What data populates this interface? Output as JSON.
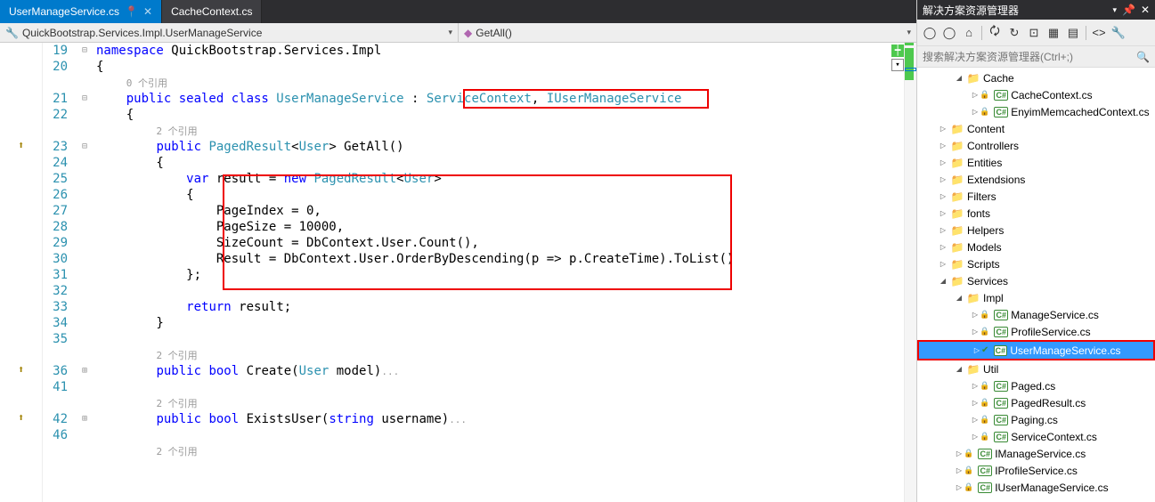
{
  "tabs": [
    {
      "label": "UserManageService.cs",
      "active": true,
      "pinned": true
    },
    {
      "label": "CacheContext.cs",
      "active": false,
      "pinned": false
    }
  ],
  "breadcrumb": {
    "left_icon": "🔧",
    "left": "QuickBootstrap.Services.Impl.UserManageService",
    "right_icon": "◆",
    "right": "GetAll()"
  },
  "code": {
    "lines": [
      {
        "num": "19",
        "fold": "⊟",
        "segs": [
          {
            "t": "namespace ",
            "c": "kw"
          },
          {
            "t": "QuickBootstrap.Services.Impl",
            "c": ""
          }
        ]
      },
      {
        "num": "20",
        "fold": "",
        "segs": [
          {
            "t": "{",
            "c": ""
          }
        ]
      },
      {
        "num": "",
        "fold": "",
        "segs": [
          {
            "t": "    ",
            "c": ""
          },
          {
            "t": "0 个引用",
            "c": "codelens"
          }
        ]
      },
      {
        "num": "21",
        "fold": "⊟",
        "segs": [
          {
            "t": "    ",
            "c": ""
          },
          {
            "t": "public sealed class ",
            "c": "kw"
          },
          {
            "t": "UserManageService",
            "c": "type"
          },
          {
            "t": " : ",
            "c": ""
          },
          {
            "t": "ServiceContext",
            "c": "type"
          },
          {
            "t": ", ",
            "c": ""
          },
          {
            "t": "IUserManageService",
            "c": "type"
          }
        ]
      },
      {
        "num": "22",
        "fold": "",
        "segs": [
          {
            "t": "    {",
            "c": ""
          }
        ]
      },
      {
        "num": "",
        "fold": "",
        "segs": [
          {
            "t": "        ",
            "c": ""
          },
          {
            "t": "2 个引用",
            "c": "codelens"
          }
        ]
      },
      {
        "num": "23",
        "fold": "⊟",
        "segs": [
          {
            "t": "        ",
            "c": ""
          },
          {
            "t": "public ",
            "c": "kw"
          },
          {
            "t": "PagedResult",
            "c": "type"
          },
          {
            "t": "<",
            "c": ""
          },
          {
            "t": "User",
            "c": "type"
          },
          {
            "t": "> GetAll()",
            "c": ""
          }
        ],
        "glyph": "↑"
      },
      {
        "num": "24",
        "fold": "",
        "segs": [
          {
            "t": "        {",
            "c": ""
          }
        ]
      },
      {
        "num": "25",
        "fold": "",
        "segs": [
          {
            "t": "            ",
            "c": ""
          },
          {
            "t": "var ",
            "c": "kw"
          },
          {
            "t": "result = ",
            "c": ""
          },
          {
            "t": "new ",
            "c": "kw"
          },
          {
            "t": "PagedResult",
            "c": "type"
          },
          {
            "t": "<",
            "c": ""
          },
          {
            "t": "User",
            "c": "type"
          },
          {
            "t": ">",
            "c": ""
          }
        ]
      },
      {
        "num": "26",
        "fold": "",
        "segs": [
          {
            "t": "            {",
            "c": ""
          }
        ]
      },
      {
        "num": "27",
        "fold": "",
        "segs": [
          {
            "t": "                PageIndex = 0,",
            "c": ""
          }
        ]
      },
      {
        "num": "28",
        "fold": "",
        "segs": [
          {
            "t": "                PageSize = 10000,",
            "c": ""
          }
        ]
      },
      {
        "num": "29",
        "fold": "",
        "segs": [
          {
            "t": "                SizeCount = DbContext.User.Count(),",
            "c": ""
          }
        ]
      },
      {
        "num": "30",
        "fold": "",
        "segs": [
          {
            "t": "                Result = DbContext.User.OrderByDescending(p => p.CreateTime).ToList()",
            "c": ""
          }
        ]
      },
      {
        "num": "31",
        "fold": "",
        "segs": [
          {
            "t": "            };",
            "c": ""
          }
        ]
      },
      {
        "num": "32",
        "fold": "",
        "segs": [
          {
            "t": "",
            "c": ""
          }
        ]
      },
      {
        "num": "33",
        "fold": "",
        "segs": [
          {
            "t": "            ",
            "c": ""
          },
          {
            "t": "return ",
            "c": "kw"
          },
          {
            "t": "result;",
            "c": ""
          }
        ]
      },
      {
        "num": "34",
        "fold": "",
        "segs": [
          {
            "t": "        }",
            "c": ""
          }
        ]
      },
      {
        "num": "35",
        "fold": "",
        "segs": [
          {
            "t": "",
            "c": ""
          }
        ]
      },
      {
        "num": "",
        "fold": "",
        "segs": [
          {
            "t": "        ",
            "c": ""
          },
          {
            "t": "2 个引用",
            "c": "codelens"
          }
        ]
      },
      {
        "num": "36",
        "fold": "⊞",
        "segs": [
          {
            "t": "        ",
            "c": ""
          },
          {
            "t": "public bool ",
            "c": "kw"
          },
          {
            "t": "Create(",
            "c": ""
          },
          {
            "t": "User",
            "c": "type"
          },
          {
            "t": " model)",
            "c": ""
          },
          {
            "t": "...",
            "c": "codelens"
          }
        ],
        "glyph": "↑"
      },
      {
        "num": "41",
        "fold": "",
        "segs": [
          {
            "t": "",
            "c": ""
          }
        ]
      },
      {
        "num": "",
        "fold": "",
        "segs": [
          {
            "t": "        ",
            "c": ""
          },
          {
            "t": "2 个引用",
            "c": "codelens"
          }
        ]
      },
      {
        "num": "42",
        "fold": "⊞",
        "segs": [
          {
            "t": "        ",
            "c": ""
          },
          {
            "t": "public bool ",
            "c": "kw"
          },
          {
            "t": "ExistsUser(",
            "c": ""
          },
          {
            "t": "string ",
            "c": "kw"
          },
          {
            "t": "username)",
            "c": ""
          },
          {
            "t": "...",
            "c": "codelens"
          }
        ],
        "glyph": "↑"
      },
      {
        "num": "46",
        "fold": "",
        "segs": [
          {
            "t": "",
            "c": ""
          }
        ]
      },
      {
        "num": "",
        "fold": "",
        "segs": [
          {
            "t": "        ",
            "c": ""
          },
          {
            "t": "2 个引用",
            "c": "codelens"
          }
        ]
      }
    ]
  },
  "solution": {
    "title": "解决方案资源管理器",
    "search_placeholder": "搜索解决方案资源管理器(Ctrl+;)",
    "tree": [
      {
        "depth": 2,
        "caret": "◢",
        "icon": "folder",
        "label": "Cache"
      },
      {
        "depth": 3,
        "caret": "▷",
        "icon": "cs",
        "lock": true,
        "label": "CacheContext.cs"
      },
      {
        "depth": 3,
        "caret": "▷",
        "icon": "cs",
        "lock": true,
        "label": "EnyimMemcachedContext.cs"
      },
      {
        "depth": 1,
        "caret": "▷",
        "icon": "folder",
        "label": "Content"
      },
      {
        "depth": 1,
        "caret": "▷",
        "icon": "folder",
        "label": "Controllers"
      },
      {
        "depth": 1,
        "caret": "▷",
        "icon": "folder",
        "label": "Entities"
      },
      {
        "depth": 1,
        "caret": "▷",
        "icon": "folder",
        "label": "Extendsions"
      },
      {
        "depth": 1,
        "caret": "▷",
        "icon": "folder",
        "label": "Filters"
      },
      {
        "depth": 1,
        "caret": "▷",
        "icon": "folder",
        "label": "fonts"
      },
      {
        "depth": 1,
        "caret": "▷",
        "icon": "folder",
        "label": "Helpers"
      },
      {
        "depth": 1,
        "caret": "▷",
        "icon": "folder",
        "label": "Models"
      },
      {
        "depth": 1,
        "caret": "▷",
        "icon": "folder",
        "label": "Scripts"
      },
      {
        "depth": 1,
        "caret": "◢",
        "icon": "folder",
        "label": "Services"
      },
      {
        "depth": 2,
        "caret": "◢",
        "icon": "folder",
        "label": "Impl"
      },
      {
        "depth": 3,
        "caret": "▷",
        "icon": "cs",
        "lock": true,
        "label": "ManageService.cs"
      },
      {
        "depth": 3,
        "caret": "▷",
        "icon": "cs",
        "lock": true,
        "label": "ProfileService.cs"
      },
      {
        "depth": 3,
        "caret": "▷",
        "icon": "cs",
        "check": true,
        "label": "UserManageService.cs",
        "selected": true,
        "red": true
      },
      {
        "depth": 2,
        "caret": "◢",
        "icon": "folder",
        "label": "Util"
      },
      {
        "depth": 3,
        "caret": "▷",
        "icon": "cs",
        "lock": true,
        "label": "Paged.cs"
      },
      {
        "depth": 3,
        "caret": "▷",
        "icon": "cs",
        "lock": true,
        "label": "PagedResult.cs"
      },
      {
        "depth": 3,
        "caret": "▷",
        "icon": "cs",
        "lock": true,
        "label": "Paging.cs"
      },
      {
        "depth": 3,
        "caret": "▷",
        "icon": "cs",
        "lock": true,
        "label": "ServiceContext.cs"
      },
      {
        "depth": 2,
        "caret": "▷",
        "icon": "cs",
        "lock": true,
        "label": "IManageService.cs"
      },
      {
        "depth": 2,
        "caret": "▷",
        "icon": "cs",
        "lock": true,
        "label": "IProfileService.cs"
      },
      {
        "depth": 2,
        "caret": "▷",
        "icon": "cs",
        "lock": true,
        "label": "IUserManageService.cs"
      }
    ]
  }
}
